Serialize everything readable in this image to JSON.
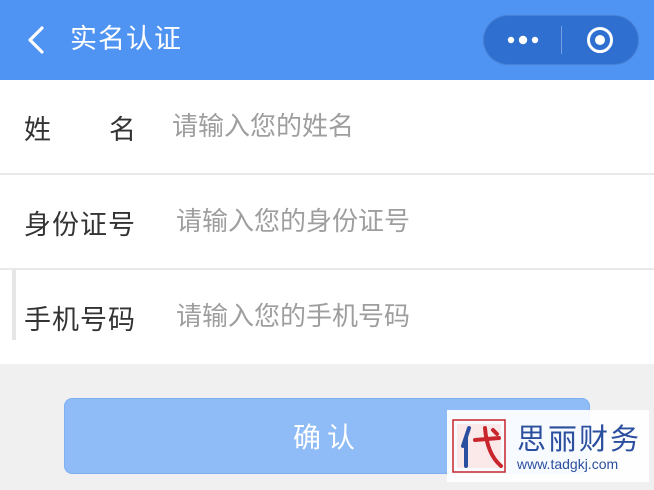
{
  "header": {
    "title": "实名认证",
    "back_icon": "chevron-left-icon",
    "more_icon": "more-dots-icon",
    "close_icon": "target-close-icon",
    "bg_color": "#4f94f2"
  },
  "form": {
    "name": {
      "label_chars": [
        "姓",
        "名"
      ],
      "placeholder": "请输入您的姓名",
      "value": ""
    },
    "id_number": {
      "label": "身份证号",
      "placeholder": "请输入您的身份证号",
      "value": ""
    },
    "phone": {
      "label": "手机号码",
      "placeholder": "请输入您的手机号码",
      "value": ""
    }
  },
  "confirm_button": {
    "label": "确认",
    "color": "#8fbcf6"
  },
  "watermark": {
    "name": "思丽财务",
    "url": "www.tadgkj.com"
  }
}
